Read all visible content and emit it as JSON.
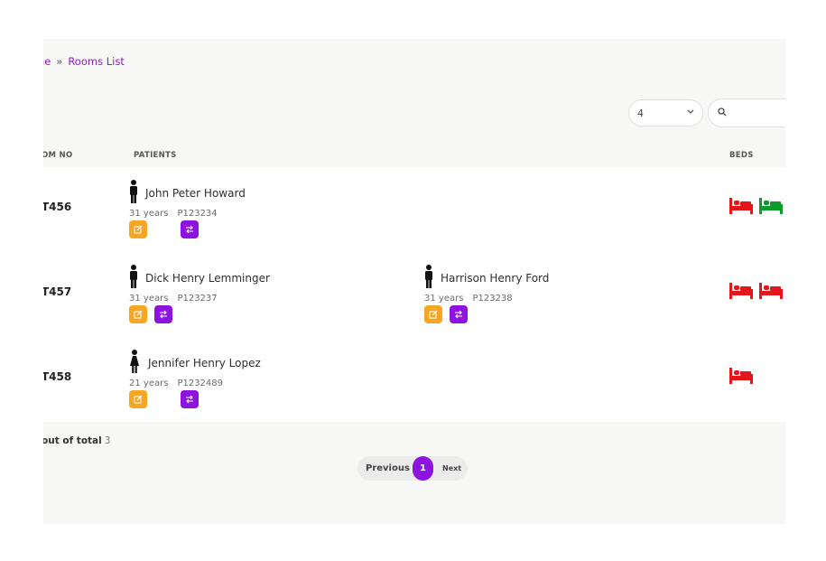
{
  "breadcrumb": {
    "first": "me",
    "separator": "»",
    "current": "Rooms List"
  },
  "controls": {
    "page_size_value": "4",
    "search_placeholder": ""
  },
  "table": {
    "headers": {
      "room_no": "OM NO",
      "patients": "PATIENTS",
      "beds": "BEDS"
    },
    "rows": [
      {
        "room_no": "T456",
        "patients": [
          {
            "name": "John Peter Howard",
            "age": "31 years",
            "id": "P123234",
            "gender_icon": "male-icon"
          }
        ],
        "beds": [
          "occupied",
          "vacant"
        ]
      },
      {
        "room_no": "T457",
        "patients": [
          {
            "name": "Dick Henry Lemminger",
            "age": "31 years",
            "id": "P123237",
            "gender_icon": "male-icon"
          },
          {
            "name": "Harrison Henry Ford",
            "age": "31 years",
            "id": "P123238",
            "gender_icon": "male-icon"
          }
        ],
        "beds": [
          "occupied",
          "occupied"
        ]
      },
      {
        "room_no": "T458",
        "patients": [
          {
            "name": "Jennifer Henry Lopez",
            "age": "21 years",
            "id": "P1232489",
            "gender_icon": "female-icon"
          }
        ],
        "beds": [
          "occupied"
        ]
      }
    ]
  },
  "footer": {
    "summary_label": "out of total",
    "total": "3"
  },
  "pagination": {
    "previous": "Previous",
    "current": "1",
    "next": "Next"
  },
  "colors": {
    "accent": "#8e13e0",
    "edit": "#f5a623",
    "bed_occupied": "#e3161b",
    "bed_vacant": "#0f9a2c"
  }
}
